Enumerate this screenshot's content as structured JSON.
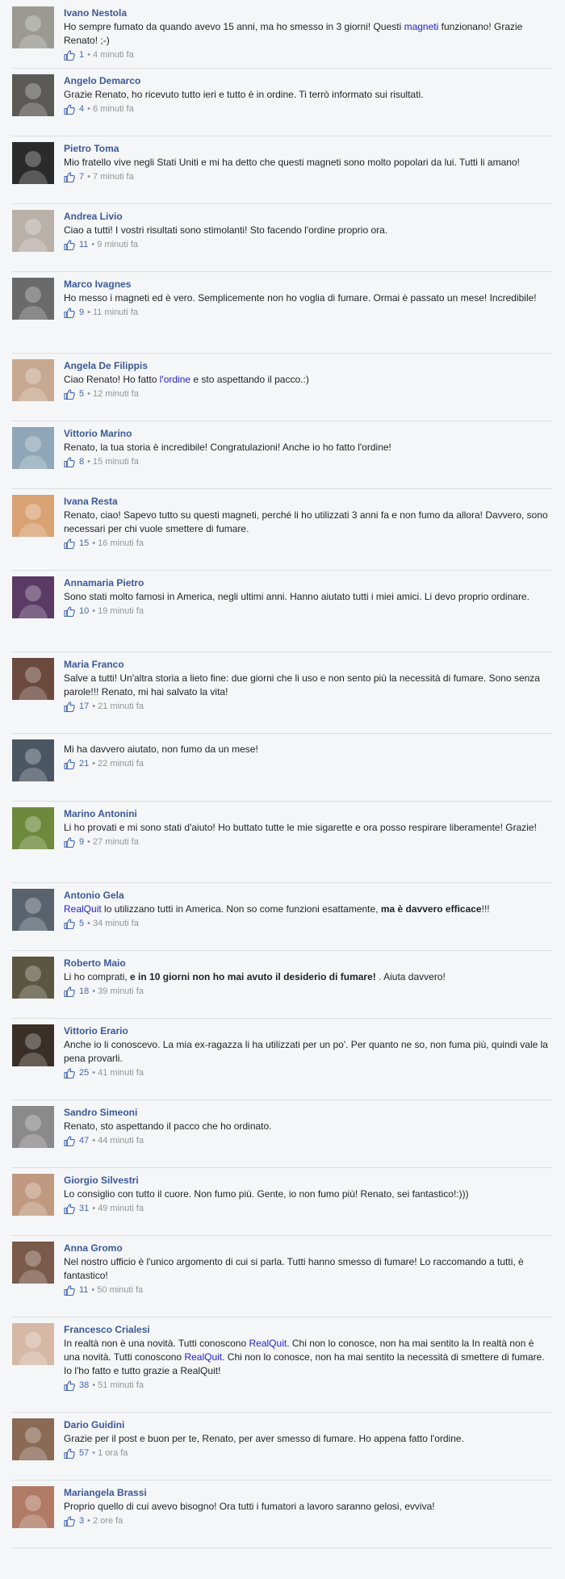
{
  "comments": [
    {
      "author": "Ivano Nestola",
      "segments": [
        {
          "t": "Ho sempre fumato da quando avevo 15 anni, ma ho smesso in 3 giorni! Questi "
        },
        {
          "t": "magneti",
          "s": "link"
        },
        {
          "t": " funzionano! Grazie Renato! ;-)"
        }
      ],
      "likes": "1",
      "time": "4 minuti fa",
      "avatar_color": "#9a9a92"
    },
    {
      "author": "Angelo Demarco",
      "segments": [
        {
          "t": "Grazie Renato, ho ricevuto tutto ieri e tutto è in ordine. Ti terrò informato sui risultati."
        }
      ],
      "likes": "4",
      "time": "6 minuti fa",
      "avatar_color": "#5b5a56"
    },
    {
      "author": "Pietro Toma",
      "segments": [
        {
          "t": "Mio fratello vive negli Stati Uniti e mi ha detto che questi magneti sono molto popolari da lui. Tutti li amano!"
        }
      ],
      "likes": "7",
      "time": "7 minuti fa",
      "avatar_color": "#2b2b2b"
    },
    {
      "author": "Andrea Livio",
      "segments": [
        {
          "t": "Ciao a tutti! I vostri risultati sono stimolanti! Sto facendo l'ordine proprio ora."
        }
      ],
      "likes": "11",
      "time": "9 minuti fa",
      "avatar_color": "#b9b0a8"
    },
    {
      "author": "Marco Ivagnes",
      "segments": [
        {
          "t": "Ho messo i magneti ed è vero. Semplicemente non ho voglia di fumare. Ormai è passato un mese! Incredibile!"
        }
      ],
      "likes": "9",
      "time": "11 minuti fa",
      "avatar_color": "#6a6a6a"
    },
    {
      "author": "Angela De Filippis",
      "segments": [
        {
          "t": "Ciao Renato! Ho fatto "
        },
        {
          "t": "l'ordine",
          "s": "link"
        },
        {
          "t": " e sto aspettando il pacco.:)"
        }
      ],
      "likes": "5",
      "time": "12 minuti fa",
      "avatar_color": "#c7a890"
    },
    {
      "author": "Vittorio Marino",
      "segments": [
        {
          "t": "Renato, la tua storia è incredibile! Congratulazioni! Anche io ho fatto l'ordine!"
        }
      ],
      "likes": "8",
      "time": "15 minuti fa",
      "avatar_color": "#8fa7b8"
    },
    {
      "author": "Ivana Resta",
      "segments": [
        {
          "t": "Renato, ciao! Sapevo tutto su questi magneti, perché li ho utilizzati 3 anni fa e non fumo da allora! Davvero, sono necessari per chi vuole smettere di fumare."
        }
      ],
      "likes": "15",
      "time": "16 minuti fa",
      "avatar_color": "#d9a273"
    },
    {
      "author": "Annamaria Pietro",
      "segments": [
        {
          "t": "Sono stati molto famosi in America, negli ultimi anni. Hanno aiutato tutti i miei amici. Li devo proprio ordinare."
        }
      ],
      "likes": "10",
      "time": "19 minuti fa",
      "avatar_color": "#5b3a66"
    },
    {
      "author": "Maria Franco",
      "segments": [
        {
          "t": "Salve a tutti! Un'altra storia a lieto fine: due giorni che li uso e non sento più la necessità di fumare. Sono senza parole!!! Renato, mi hai salvato la vita!"
        }
      ],
      "likes": "17",
      "time": "21 minuti fa",
      "avatar_color": "#6b4a3e"
    },
    {
      "author": "",
      "segments": [
        {
          "t": "Mi ha davvero aiutato, non fumo da un mese!"
        }
      ],
      "likes": "21",
      "time": "22 minuti fa",
      "avatar_color": "#4b5663"
    },
    {
      "author": "Marino Antonini",
      "segments": [
        {
          "t": "Li ho provati e mi sono stati d'aiuto! Ho buttato tutte le mie sigarette e ora posso respirare liberamente! Grazie!"
        }
      ],
      "likes": "9",
      "time": "27 minuti fa",
      "avatar_color": "#6d8a3c"
    },
    {
      "author": "Antonio Gela",
      "segments": [
        {
          "t": "RealQuit",
          "s": "link"
        },
        {
          "t": " lo utilizzano tutti in America. Non so come funzioni esattamente, "
        },
        {
          "t": "ma è davvero efficace",
          "s": "bold"
        },
        {
          "t": "!!!"
        }
      ],
      "likes": "5",
      "time": "34 minuti fa",
      "avatar_color": "#58636e"
    },
    {
      "author": "Roberto Maio",
      "segments": [
        {
          "t": "Li ho comprati, "
        },
        {
          "t": "e in 10 giorni non ho mai avuto il desiderio di fumare!",
          "s": "bold"
        },
        {
          "t": " . Aiuta davvero!"
        }
      ],
      "likes": "18",
      "time": "39 minuti fa",
      "avatar_color": "#5a5640"
    },
    {
      "author": "Vittorio Erario",
      "segments": [
        {
          "t": "Anche io li conoscevo. La mia ex-ragazza li ha utilizzati per un po'. Per quanto ne so, non fuma più, quindi vale la pena provarli."
        }
      ],
      "likes": "25",
      "time": "41 minuti fa",
      "avatar_color": "#3a2f27"
    },
    {
      "author": "Sandro Simeoni",
      "segments": [
        {
          "t": "Renato, sto aspettando il pacco che ho ordinato."
        }
      ],
      "likes": "47",
      "time": "44 minuti fa",
      "avatar_color": "#8a8a8a"
    },
    {
      "author": "Giorgio Silvestri",
      "segments": [
        {
          "t": "Lo consiglio con tutto il cuore. Non fumo più. Gente, io non fumo più! Renato, sei fantastico!:)))"
        }
      ],
      "likes": "31",
      "time": "49 minuti fa",
      "avatar_color": "#c09a80"
    },
    {
      "author": "Anna Gromo",
      "segments": [
        {
          "t": "Nel nostro ufficio è l'unico argomento di cui si parla. Tutti hanno smesso di fumare! Lo raccomando a tutti, è fantastico!"
        }
      ],
      "likes": "11",
      "time": "50 minuti fa",
      "avatar_color": "#7a5a4a"
    },
    {
      "author": "Francesco Crialesi",
      "segments": [
        {
          "t": "In realtà non è una novità. Tutti conoscono "
        },
        {
          "t": "RealQuit",
          "s": "link"
        },
        {
          "t": ". Chi non lo conosce, non ha mai sentito la In realtà non è una novità. Tutti conoscono "
        },
        {
          "t": "RealQuit",
          "s": "link"
        },
        {
          "t": ". Chi non lo conosce, non ha mai sentito la necessità di smettere di fumare. Io l'ho fatto e tutto grazie a RealQuit!"
        }
      ],
      "likes": "38",
      "time": "51 minuti fa",
      "avatar_color": "#d6b8a6"
    },
    {
      "author": "Dario Guidini",
      "segments": [
        {
          "t": "Grazie per il post e buon per te, Renato, per aver smesso di fumare. Ho appena fatto l'ordine."
        }
      ],
      "likes": "57",
      "time": "1 ora fa",
      "avatar_color": "#8a6a55"
    },
    {
      "author": "Mariangela Brassi",
      "segments": [
        {
          "t": "Proprio quello di cui avevo bisogno! Ora tutti i fumatori a lavoro saranno gelosi, evviva!"
        }
      ],
      "likes": "3",
      "time": "2 ore fa",
      "avatar_color": "#b07a66"
    }
  ]
}
